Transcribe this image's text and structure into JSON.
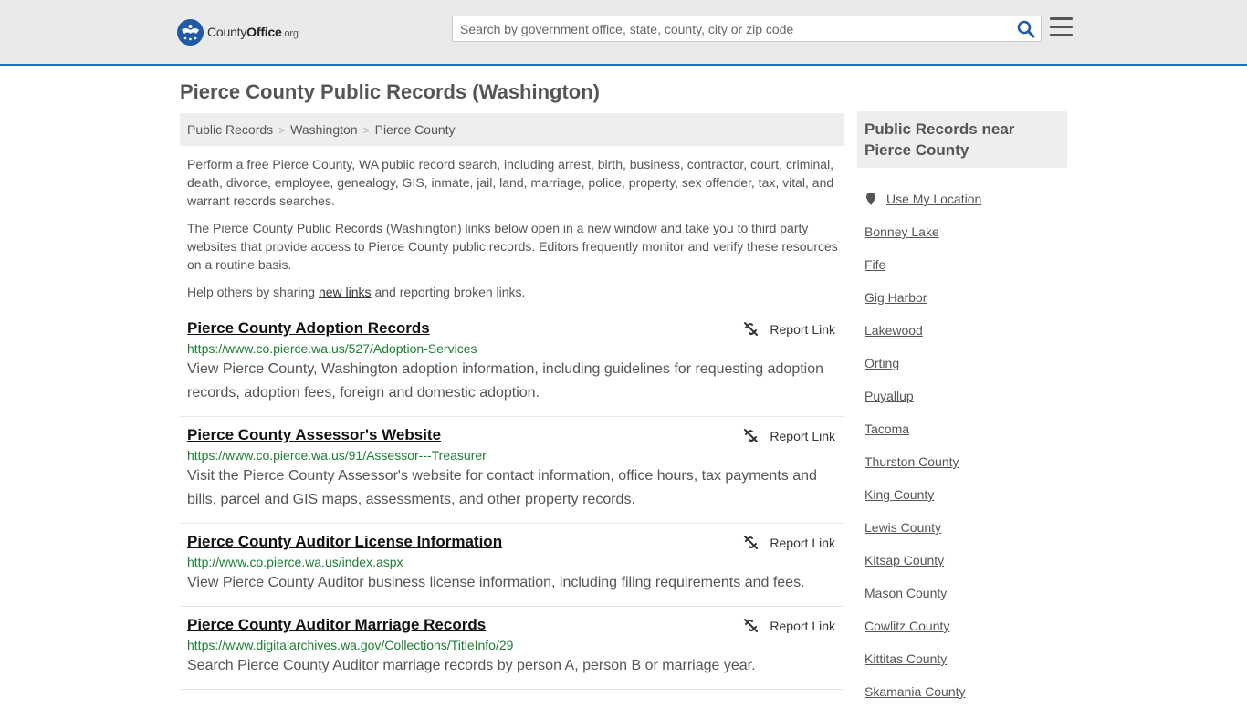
{
  "header": {
    "logo_prefix": "County",
    "logo_bold": "Office",
    "logo_suffix": ".org",
    "search_placeholder": "Search by government office, state, county, city or zip code",
    "search_icon": "search-icon",
    "menu_icon": "hamburger-menu-icon",
    "accent_color": "#1e73be"
  },
  "page": {
    "title": "Pierce County Public Records (Washington)"
  },
  "breadcrumb": [
    "Public Records",
    "Washington",
    "Pierce County"
  ],
  "intro": {
    "p1": "Perform a free Pierce County, WA public record search, including arrest, birth, business, contractor, court, criminal, death, divorce, employee, genealogy, GIS, inmate, jail, land, marriage, police, property, sex offender, tax, vital, and warrant records searches.",
    "p2": "The Pierce County Public Records (Washington) links below open in a new window and take you to third party websites that provide access to Pierce County public records. Editors frequently monitor and verify these resources on a routine basis.",
    "p3_before": "Help others by sharing ",
    "p3_link": "new links",
    "p3_after": " and reporting broken links."
  },
  "records": [
    {
      "title": "Pierce County Adoption Records",
      "report_label": "Report Link",
      "url": "https://www.co.pierce.wa.us/527/Adoption-Services",
      "desc": "View Pierce County, Washington adoption information, including guidelines for requesting adoption records, adoption fees, foreign and domestic adoption."
    },
    {
      "title": "Pierce County Assessor's Website",
      "report_label": "Report Link",
      "url": "https://www.co.pierce.wa.us/91/Assessor---Treasurer",
      "desc": "Visit the Pierce County Assessor's website for contact information, office hours, tax payments and bills, parcel and GIS maps, assessments, and other property records."
    },
    {
      "title": "Pierce County Auditor License Information",
      "report_label": "Report Link",
      "url": "http://www.co.pierce.wa.us/index.aspx",
      "desc": "View Pierce County Auditor business license information, including filing requirements and fees."
    },
    {
      "title": "Pierce County Auditor Marriage Records",
      "report_label": "Report Link",
      "url": "https://www.digitalarchives.wa.gov/Collections/TitleInfo/29",
      "desc": "Search Pierce County Auditor marriage records by person A, person B or marriage year."
    }
  ],
  "aside": {
    "title": "Public Records near Pierce County",
    "use_location": "Use My Location",
    "location_icon": "map-pin-icon",
    "links": [
      "Bonney Lake",
      "Fife",
      "Gig Harbor",
      "Lakewood",
      "Orting",
      "Puyallup",
      "Tacoma",
      "Thurston County",
      "King County",
      "Lewis County",
      "Kitsap County",
      "Mason County",
      "Cowlitz County",
      "Kittitas County",
      "Skamania County"
    ]
  }
}
